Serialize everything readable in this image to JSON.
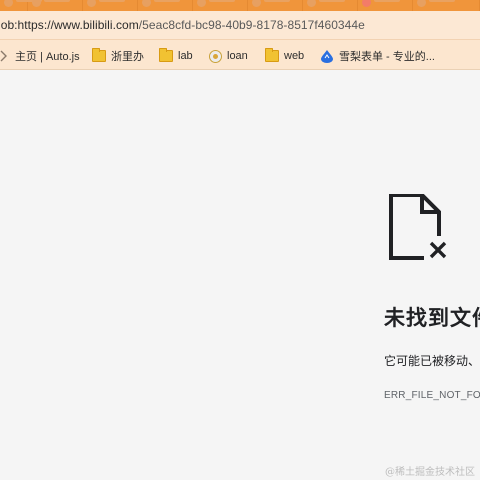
{
  "browser": {
    "address_bar": {
      "url_prefix": "lob:https://www.bilibili.com",
      "url_rest": "/5eac8cfd-bc98-40b9-8178-8517f460344e"
    },
    "bookmarks": [
      {
        "label": "主页 | Auto.js",
        "icon": "chevron-icon"
      },
      {
        "label": "浙里办",
        "icon": "folder-icon"
      },
      {
        "label": "lab",
        "icon": "folder-icon"
      },
      {
        "label": "loan",
        "icon": "globe-icon"
      },
      {
        "label": "web",
        "icon": "folder-icon"
      },
      {
        "label": "雪梨表单 - 专业的...",
        "icon": "water-drop-icon"
      }
    ]
  },
  "error_page": {
    "icon": "file-not-found-icon",
    "title": "未找到文件",
    "description": "它可能已被移动、",
    "error_code": "ERR_FILE_NOT_FOUND"
  },
  "watermark": "@稀土掘金技术社区",
  "colors": {
    "tab_strip": "#f0953b",
    "address_bar_bg": "#fce8d4",
    "bookmarks_bg": "#fce6cf",
    "page_bg": "#f5f5f5",
    "folder": "#f1c232"
  }
}
